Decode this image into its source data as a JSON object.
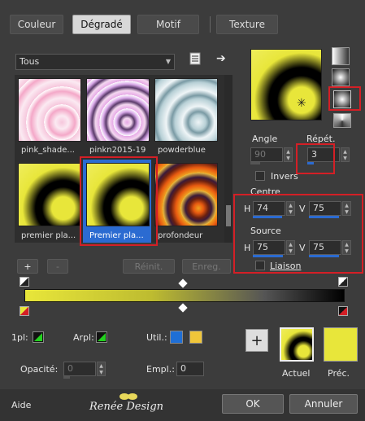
{
  "tabs": [
    {
      "label": "Couleur"
    },
    {
      "label": "Dégradé"
    },
    {
      "label": "Motif"
    },
    {
      "label": "Texture"
    }
  ],
  "gradient_select": {
    "value": "Tous"
  },
  "thumbnails": [
    {
      "caption": "pink_shade..."
    },
    {
      "caption": "pinkn2015-19"
    },
    {
      "caption": "powderblue"
    },
    {
      "caption": "premier pla..."
    },
    {
      "caption": "Premier pla..."
    },
    {
      "caption": "profondeur"
    }
  ],
  "angle": {
    "label": "Angle",
    "value": "90"
  },
  "repet": {
    "label": "Répét.",
    "value": "3"
  },
  "invers": {
    "label": "Invers"
  },
  "centre": {
    "label": "Centre",
    "h_label": "H",
    "h_value": "74",
    "v_label": "V",
    "v_value": "75"
  },
  "source": {
    "label": "Source",
    "h_label": "H",
    "h_value": "75",
    "v_label": "V",
    "v_value": "75"
  },
  "liaison": {
    "label": "Liaison"
  },
  "buttons": {
    "add": "+",
    "remove": "-",
    "reinit": "Réinit.",
    "enreg": "Enreg.",
    "ok": "OK",
    "annuler": "Annuler",
    "aide": "Aide"
  },
  "bottom": {
    "lpl_label": "1pl:",
    "arpl_label": "Arpl:",
    "util_label": "Util.:",
    "opacite_label": "Opacité:",
    "opacite_value": "0",
    "empl_label": "Empl.:",
    "empl_value": "0"
  },
  "preview": {
    "actuel": "Actuel",
    "prec": "Préc."
  },
  "watermark": "Renée Design",
  "colors": {
    "accent": "#2b6bd1",
    "yellow": "#e8e63a",
    "highlight_red": "#d41f26",
    "green": "#22d11e",
    "util_blue": "#1f6fd6",
    "util_yellow": "#f0c63a"
  }
}
